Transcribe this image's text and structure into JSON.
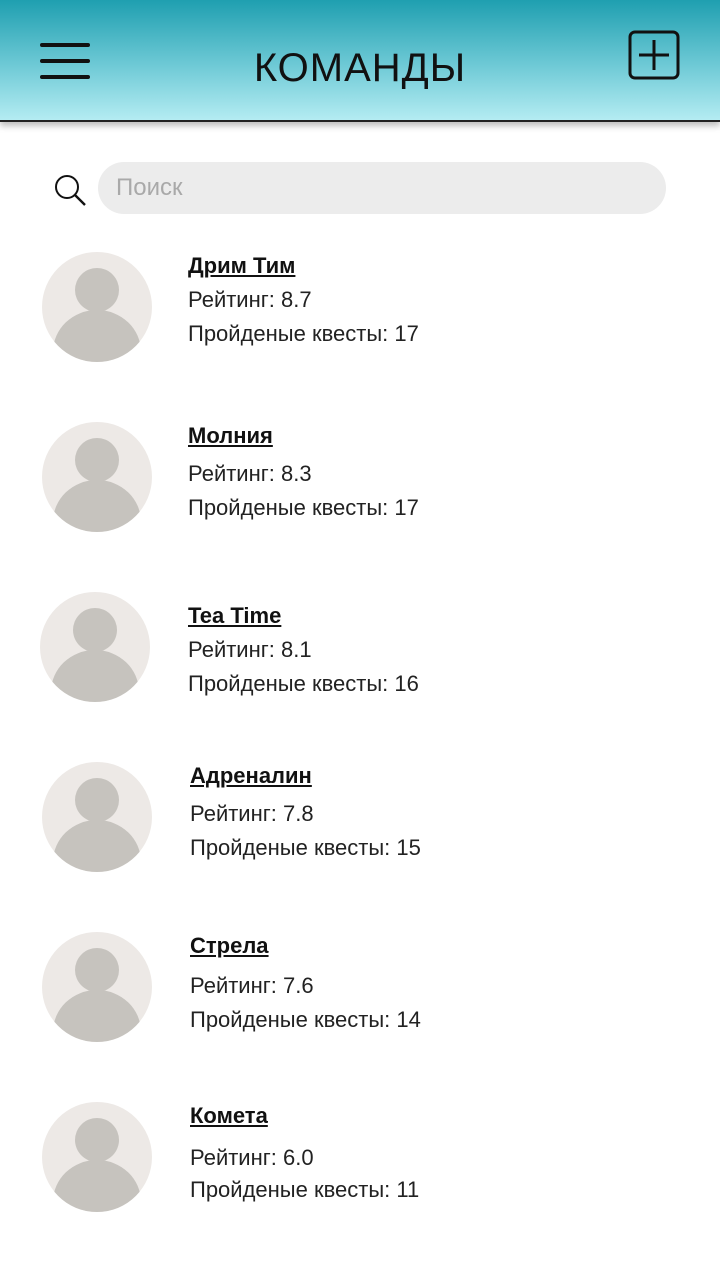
{
  "header": {
    "title": "КОМАНДЫ",
    "menu_icon": "hamburger-menu-icon",
    "add_icon": "add-square-icon"
  },
  "search": {
    "placeholder": "Поиск",
    "value": "",
    "icon": "search-icon"
  },
  "colors": {
    "header_gradient_top": "#1f9fb0",
    "header_gradient_bottom": "#b4ecf2",
    "avatar_bg": "#ede9e6",
    "avatar_figure": "#c6c3be",
    "search_bg": "#ececec"
  },
  "teams": [
    {
      "name": "Дрим Тим",
      "rating": "Рейтинг: 8.7",
      "quests": "Пройденые квесты: 17"
    },
    {
      "name": "Молния",
      "rating": "Рейтинг: 8.3",
      "quests": "Пройденые квесты: 17"
    },
    {
      "name": "Tea Time",
      "rating": "Рейтинг: 8.1",
      "quests": "Пройденые квесты: 16"
    },
    {
      "name": "Адреналин",
      "rating": "Рейтинг: 7.8",
      "quests": "Пройденые квесты: 15"
    },
    {
      "name": "Стрела",
      "rating": "Рейтинг: 7.6",
      "quests": "Пройденые квесты: 14"
    },
    {
      "name": "Комета",
      "rating": "Рейтинг: 6.0",
      "quests": "Пройденые квесты: 11"
    }
  ]
}
